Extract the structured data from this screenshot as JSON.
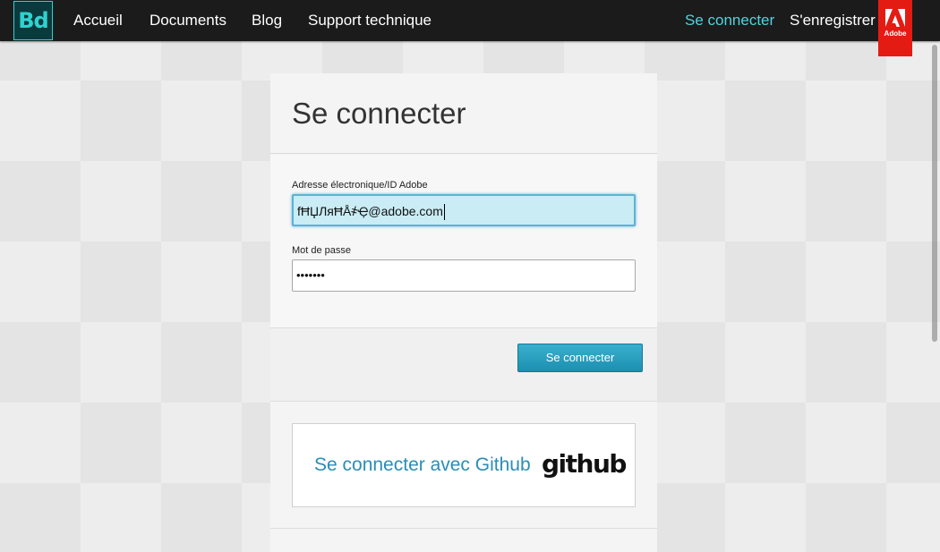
{
  "nav": {
    "logo_text": "Bd",
    "links": {
      "home": "Accueil",
      "documents": "Documents",
      "blog": "Blog",
      "support": "Support technique",
      "signin": "Se connecter",
      "register": "S'enregistrer"
    },
    "adobe_label": "Adobe",
    "colors": {
      "accent": "#4fd4e0",
      "bar": "#1b1b1b",
      "adobe_red": "#e41b13"
    }
  },
  "login": {
    "title": "Se connecter",
    "email_label": "Adresse électronique/ID Adobe",
    "email_value": "fĦЏЛяĦÅ҂Ҿ@adobe.com",
    "password_label": "Mot de passe",
    "password_value": "•••••••",
    "submit_label": "Se connecter",
    "github_label": "Se connecter avec Github",
    "github_logo_text": "github",
    "button_color": "#2aa1c2"
  }
}
